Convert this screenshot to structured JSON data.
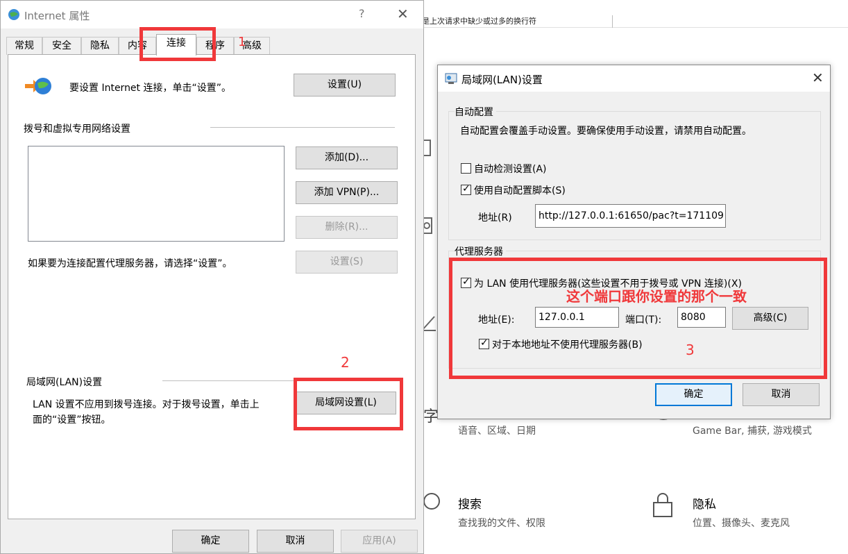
{
  "background": {
    "top_text": "是上次请求中缺少或过多的换行符",
    "items": [
      {
        "subtitle": "语音、区域、日期"
      },
      {
        "subtitle": "Game Bar, 捕获, 游戏模式"
      },
      {
        "title": "搜索",
        "subtitle": "查找我的文件、权限"
      },
      {
        "title": "隐私",
        "subtitle": "位置、摄像头、麦克风"
      }
    ]
  },
  "internet_options": {
    "title": "Internet 属性",
    "help": "?",
    "close": "✕",
    "tabs": [
      "常规",
      "安全",
      "隐私",
      "内容",
      "连接",
      "程序",
      "高级"
    ],
    "active_tab": "连接",
    "setup_text": "要设置 Internet 连接，单击“设置”。",
    "setup_button": "设置(U)",
    "dialup_group": "拨号和虚拟专用网络设置",
    "add_button": "添加(D)...",
    "add_vpn_button": "添加 VPN(P)...",
    "remove_button": "删除(R)...",
    "proxy_hint": "如果要为连接配置代理服务器，请选择“设置”。",
    "settings_button": "设置(S)",
    "lan_group": "局域网(LAN)设置",
    "lan_text_line1": "LAN 设置不应用到拨号连接。对于拨号设置，单击上",
    "lan_text_line2": "面的“设置”按钮。",
    "lan_button": "局域网设置(L)",
    "ok_button": "确定",
    "cancel_button": "取消",
    "apply_button": "应用(A)"
  },
  "lan_dialog": {
    "title": "局域网(LAN)设置",
    "close": "✕",
    "auto_group": "自动配置",
    "auto_desc": "自动配置会覆盖手动设置。要确保使用手动设置，请禁用自动配置。",
    "auto_detect_label": "自动检测设置(A)",
    "auto_detect_checked": false,
    "auto_script_label": "使用自动配置脚本(S)",
    "auto_script_checked": true,
    "address_label": "地址(R)",
    "address_value": "http://127.0.0.1:61650/pac?t=171109",
    "proxy_group": "代理服务器",
    "use_proxy_label": "为 LAN 使用代理服务器(这些设置不用于拨号或 VPN 连接)(X)",
    "use_proxy_checked": true,
    "proxy_address_label": "地址(E):",
    "proxy_address_value": "127.0.0.1",
    "port_label": "端口(T):",
    "port_value": "8080",
    "advanced_button": "高级(C)",
    "bypass_label": "对于本地地址不使用代理服务器(B)",
    "bypass_checked": true,
    "ok_button": "确定",
    "cancel_button": "取消"
  },
  "annotations": {
    "step1": "1",
    "step2": "2",
    "step3": "3",
    "note": "这个端口跟你设置的那个一致"
  },
  "colors": {
    "annotation_red": "#f0383a",
    "primary_blue": "#0078d7"
  }
}
